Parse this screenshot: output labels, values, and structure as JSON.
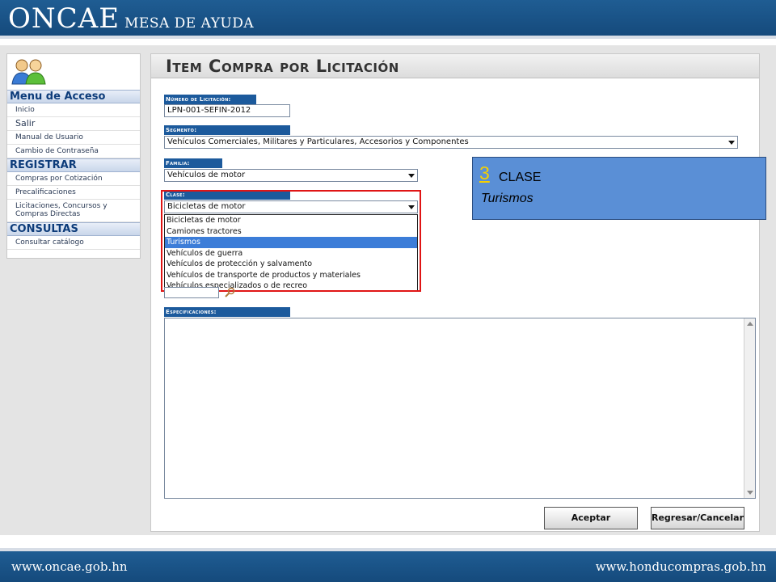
{
  "header": {
    "brand_main": "ONCAE",
    "brand_sub": "MESA DE AYUDA"
  },
  "sidebar": {
    "icon": "users-icon",
    "sections": [
      {
        "title": "Menu de Acceso",
        "items": [
          "Inicio",
          "Salir",
          "Manual de Usuario",
          "Cambio de Contraseña"
        ]
      },
      {
        "title": "REGISTRAR",
        "items": [
          "Compras por Cotización",
          "Precalificaciones",
          "Licitaciones, Concursos y Compras Directas"
        ]
      },
      {
        "title": "CONSULTAS",
        "items": [
          "Consultar catálogo"
        ]
      }
    ]
  },
  "main": {
    "title": "Item Compra por Licitación",
    "licitacion": {
      "label": "Número de Licitación:",
      "value": "LPN-001-SEFIN-2012"
    },
    "segmento": {
      "label": "Segmento:",
      "value": "Vehículos Comerciales, Militares y Particulares, Accesorios y Componentes"
    },
    "familia": {
      "label": "Familia:",
      "value": "Vehículos de motor"
    },
    "clase": {
      "label": "Clase:",
      "value": "Bicicletas de motor",
      "options": [
        "Bicicletas de motor",
        "Camiones tractores",
        "Turismos",
        "Vehículos de guerra",
        "Vehículos de protección y salvamento",
        "Vehículos de transporte de productos y materiales",
        "Vehículos especializados o de recreo"
      ],
      "highlighted": "Turismos"
    },
    "especificaciones": {
      "label": "Especificaciones:",
      "value": ""
    },
    "buttons": {
      "accept": "Aceptar",
      "back_cancel": "Regresar/Cancelar"
    }
  },
  "callout": {
    "step": "3",
    "title": "CLASE",
    "value": "Turismos"
  },
  "footer": {
    "left": "www.oncae.gob.hn",
    "right": "www.honducompras.gob.hn"
  },
  "colors": {
    "brand_blue": "#1f5d93",
    "label_blue": "#1c5a9c",
    "highlight": "#3c7dd8",
    "callout_bg": "#5a8fd6",
    "callout_number": "#f5d000",
    "annotation_red": "#e01515"
  }
}
